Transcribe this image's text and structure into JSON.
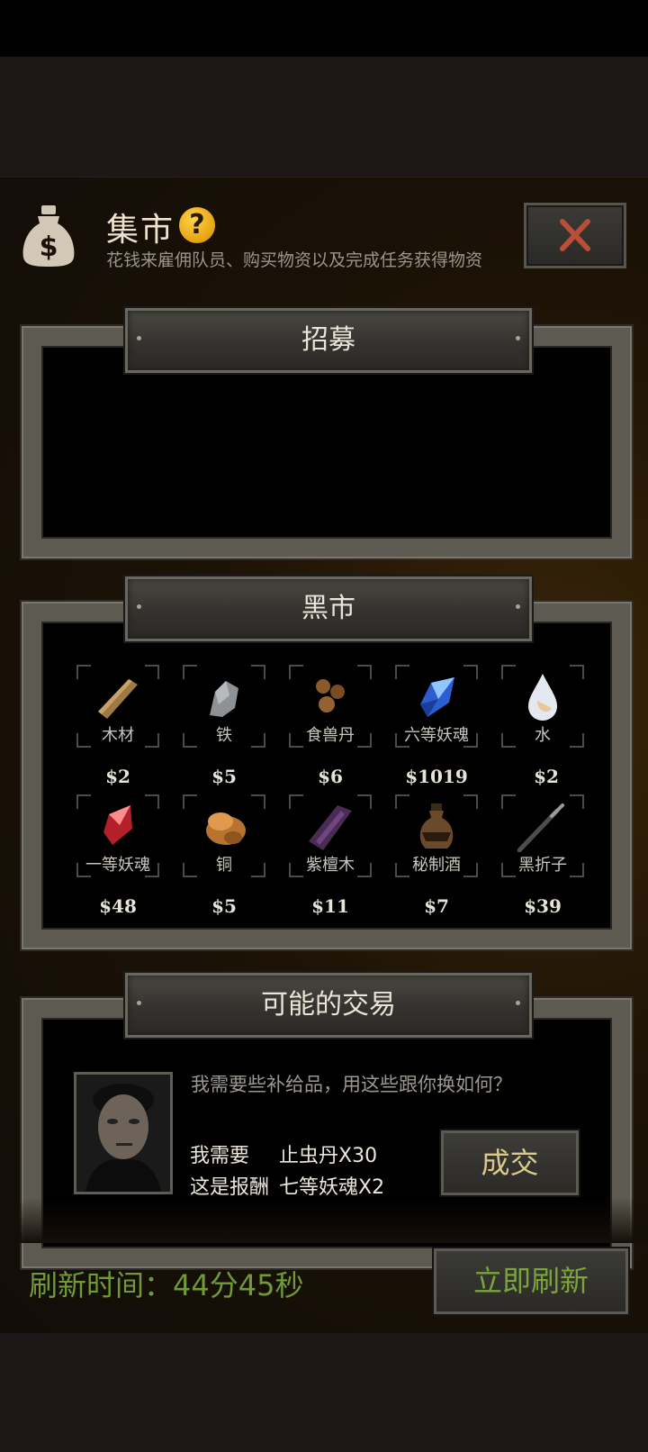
{
  "header": {
    "title": "集市",
    "subtitle": "花钱来雇佣队员、购买物资以及完成任务获得物资",
    "help_glyph": "?",
    "money_icon": "money-bag-icon",
    "close_icon": "close-icon"
  },
  "sections": {
    "recruit_title": "招募",
    "blackmarket_title": "黑市",
    "trade_title": "可能的交易"
  },
  "black_market": {
    "items": [
      {
        "name": "木材",
        "price": "$2",
        "icon": "wood-icon"
      },
      {
        "name": "铁",
        "price": "$5",
        "icon": "iron-icon"
      },
      {
        "name": "食兽丹",
        "price": "$6",
        "icon": "beast-pill-icon"
      },
      {
        "name": "六等妖魂",
        "price": "$1019",
        "icon": "blue-crystal-icon"
      },
      {
        "name": "水",
        "price": "$2",
        "icon": "water-drop-icon"
      },
      {
        "name": "一等妖魂",
        "price": "$48",
        "icon": "red-crystal-icon"
      },
      {
        "name": "铜",
        "price": "$5",
        "icon": "copper-icon"
      },
      {
        "name": "紫檀木",
        "price": "$11",
        "icon": "purple-wood-icon"
      },
      {
        "name": "秘制酒",
        "price": "$7",
        "icon": "wine-jar-icon"
      },
      {
        "name": "黑折子",
        "price": "$39",
        "icon": "black-stick-icon"
      }
    ]
  },
  "trade": {
    "message": "我需要些补给品，用这些跟你换如何？",
    "need_label": "我需要",
    "need_value": "止虫丹X30",
    "reward_label": "这是报酬",
    "reward_value": "七等妖魂X2",
    "deal_button": "成交"
  },
  "footer": {
    "refresh_time": "刷新时间：44分45秒",
    "refresh_button": "立即刷新"
  },
  "colors": {
    "accent_green": "#79a63a",
    "deal_gold": "#d9c98a",
    "close_red": "#c0553b"
  }
}
